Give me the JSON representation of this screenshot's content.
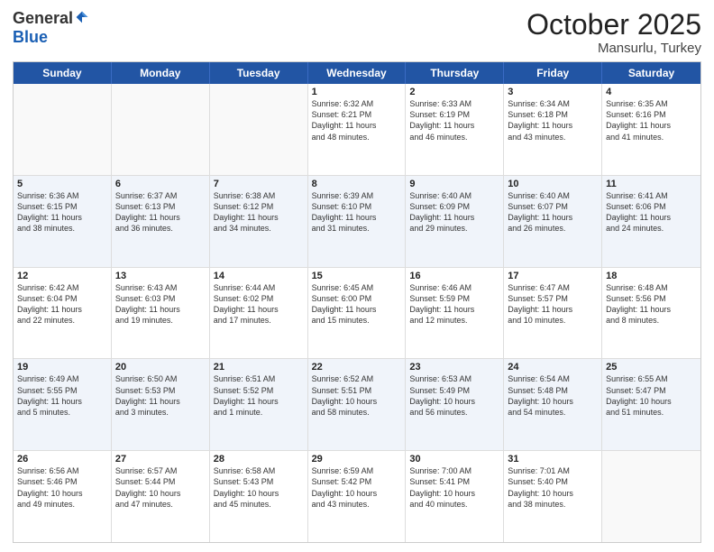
{
  "logo": {
    "general": "General",
    "blue": "Blue"
  },
  "header": {
    "month": "October 2025",
    "location": "Mansurlu, Turkey"
  },
  "days": [
    "Sunday",
    "Monday",
    "Tuesday",
    "Wednesday",
    "Thursday",
    "Friday",
    "Saturday"
  ],
  "weeks": [
    [
      {
        "day": "",
        "info": ""
      },
      {
        "day": "",
        "info": ""
      },
      {
        "day": "",
        "info": ""
      },
      {
        "day": "1",
        "info": "Sunrise: 6:32 AM\nSunset: 6:21 PM\nDaylight: 11 hours\nand 48 minutes."
      },
      {
        "day": "2",
        "info": "Sunrise: 6:33 AM\nSunset: 6:19 PM\nDaylight: 11 hours\nand 46 minutes."
      },
      {
        "day": "3",
        "info": "Sunrise: 6:34 AM\nSunset: 6:18 PM\nDaylight: 11 hours\nand 43 minutes."
      },
      {
        "day": "4",
        "info": "Sunrise: 6:35 AM\nSunset: 6:16 PM\nDaylight: 11 hours\nand 41 minutes."
      }
    ],
    [
      {
        "day": "5",
        "info": "Sunrise: 6:36 AM\nSunset: 6:15 PM\nDaylight: 11 hours\nand 38 minutes."
      },
      {
        "day": "6",
        "info": "Sunrise: 6:37 AM\nSunset: 6:13 PM\nDaylight: 11 hours\nand 36 minutes."
      },
      {
        "day": "7",
        "info": "Sunrise: 6:38 AM\nSunset: 6:12 PM\nDaylight: 11 hours\nand 34 minutes."
      },
      {
        "day": "8",
        "info": "Sunrise: 6:39 AM\nSunset: 6:10 PM\nDaylight: 11 hours\nand 31 minutes."
      },
      {
        "day": "9",
        "info": "Sunrise: 6:40 AM\nSunset: 6:09 PM\nDaylight: 11 hours\nand 29 minutes."
      },
      {
        "day": "10",
        "info": "Sunrise: 6:40 AM\nSunset: 6:07 PM\nDaylight: 11 hours\nand 26 minutes."
      },
      {
        "day": "11",
        "info": "Sunrise: 6:41 AM\nSunset: 6:06 PM\nDaylight: 11 hours\nand 24 minutes."
      }
    ],
    [
      {
        "day": "12",
        "info": "Sunrise: 6:42 AM\nSunset: 6:04 PM\nDaylight: 11 hours\nand 22 minutes."
      },
      {
        "day": "13",
        "info": "Sunrise: 6:43 AM\nSunset: 6:03 PM\nDaylight: 11 hours\nand 19 minutes."
      },
      {
        "day": "14",
        "info": "Sunrise: 6:44 AM\nSunset: 6:02 PM\nDaylight: 11 hours\nand 17 minutes."
      },
      {
        "day": "15",
        "info": "Sunrise: 6:45 AM\nSunset: 6:00 PM\nDaylight: 11 hours\nand 15 minutes."
      },
      {
        "day": "16",
        "info": "Sunrise: 6:46 AM\nSunset: 5:59 PM\nDaylight: 11 hours\nand 12 minutes."
      },
      {
        "day": "17",
        "info": "Sunrise: 6:47 AM\nSunset: 5:57 PM\nDaylight: 11 hours\nand 10 minutes."
      },
      {
        "day": "18",
        "info": "Sunrise: 6:48 AM\nSunset: 5:56 PM\nDaylight: 11 hours\nand 8 minutes."
      }
    ],
    [
      {
        "day": "19",
        "info": "Sunrise: 6:49 AM\nSunset: 5:55 PM\nDaylight: 11 hours\nand 5 minutes."
      },
      {
        "day": "20",
        "info": "Sunrise: 6:50 AM\nSunset: 5:53 PM\nDaylight: 11 hours\nand 3 minutes."
      },
      {
        "day": "21",
        "info": "Sunrise: 6:51 AM\nSunset: 5:52 PM\nDaylight: 11 hours\nand 1 minute."
      },
      {
        "day": "22",
        "info": "Sunrise: 6:52 AM\nSunset: 5:51 PM\nDaylight: 10 hours\nand 58 minutes."
      },
      {
        "day": "23",
        "info": "Sunrise: 6:53 AM\nSunset: 5:49 PM\nDaylight: 10 hours\nand 56 minutes."
      },
      {
        "day": "24",
        "info": "Sunrise: 6:54 AM\nSunset: 5:48 PM\nDaylight: 10 hours\nand 54 minutes."
      },
      {
        "day": "25",
        "info": "Sunrise: 6:55 AM\nSunset: 5:47 PM\nDaylight: 10 hours\nand 51 minutes."
      }
    ],
    [
      {
        "day": "26",
        "info": "Sunrise: 6:56 AM\nSunset: 5:46 PM\nDaylight: 10 hours\nand 49 minutes."
      },
      {
        "day": "27",
        "info": "Sunrise: 6:57 AM\nSunset: 5:44 PM\nDaylight: 10 hours\nand 47 minutes."
      },
      {
        "day": "28",
        "info": "Sunrise: 6:58 AM\nSunset: 5:43 PM\nDaylight: 10 hours\nand 45 minutes."
      },
      {
        "day": "29",
        "info": "Sunrise: 6:59 AM\nSunset: 5:42 PM\nDaylight: 10 hours\nand 43 minutes."
      },
      {
        "day": "30",
        "info": "Sunrise: 7:00 AM\nSunset: 5:41 PM\nDaylight: 10 hours\nand 40 minutes."
      },
      {
        "day": "31",
        "info": "Sunrise: 7:01 AM\nSunset: 5:40 PM\nDaylight: 10 hours\nand 38 minutes."
      },
      {
        "day": "",
        "info": ""
      }
    ]
  ]
}
